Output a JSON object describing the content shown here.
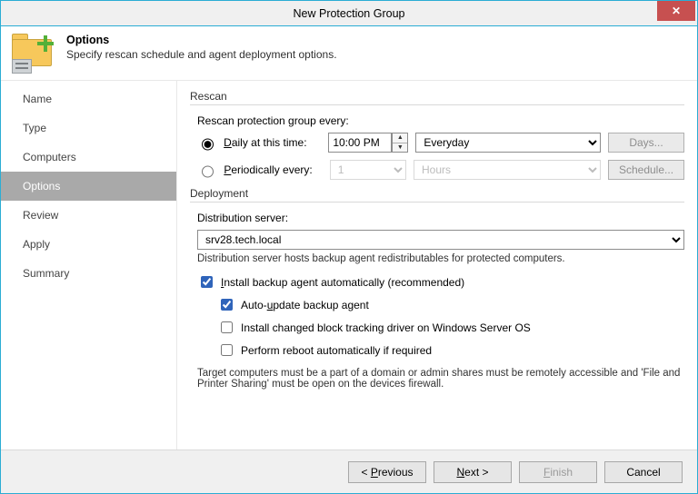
{
  "window": {
    "title": "New Protection Group"
  },
  "header": {
    "title": "Options",
    "subtitle": "Specify rescan schedule and agent deployment options."
  },
  "sidebar": {
    "items": [
      {
        "label": "Name"
      },
      {
        "label": "Type"
      },
      {
        "label": "Computers"
      },
      {
        "label": "Options"
      },
      {
        "label": "Review"
      },
      {
        "label": "Apply"
      },
      {
        "label": "Summary"
      }
    ],
    "selected_index": 3
  },
  "rescan": {
    "section": "Rescan",
    "label": "Rescan protection group every:",
    "daily_label_pre": "D",
    "daily_label_post": "aily at this time:",
    "periodic_label_pre": "P",
    "periodic_label_post": "eriodically every:",
    "time_value": "10:00 PM",
    "every_value": "Everyday",
    "period_num": "1",
    "period_unit": "Hours",
    "days_btn": "Days...",
    "schedule_btn": "Schedule..."
  },
  "deployment": {
    "section": "Deployment",
    "dist_label": "Distribution server:",
    "dist_value": "srv28.tech.local",
    "dist_note": "Distribution server hosts backup agent redistributables for protected computers.",
    "install_pre": "I",
    "install_post": "nstall backup agent automatically (recommended)",
    "auto_pre": "Auto-",
    "auto_u": "u",
    "auto_post": "pdate backup agent",
    "driver_label": "Install changed block tracking driver on Windows Server OS",
    "reboot_label": "Perform reboot automatically if required",
    "target_note": "Target computers must be a part of a domain or admin shares must be remotely accessible and 'File and Printer Sharing' must be open on the devices firewall."
  },
  "footer": {
    "prev_pre": "< ",
    "prev_u": "P",
    "prev_post": "revious",
    "next_pre": "",
    "next_u": "N",
    "next_post": "ext >",
    "finish_pre": "",
    "finish_u": "F",
    "finish_post": "inish",
    "cancel": "Cancel"
  }
}
